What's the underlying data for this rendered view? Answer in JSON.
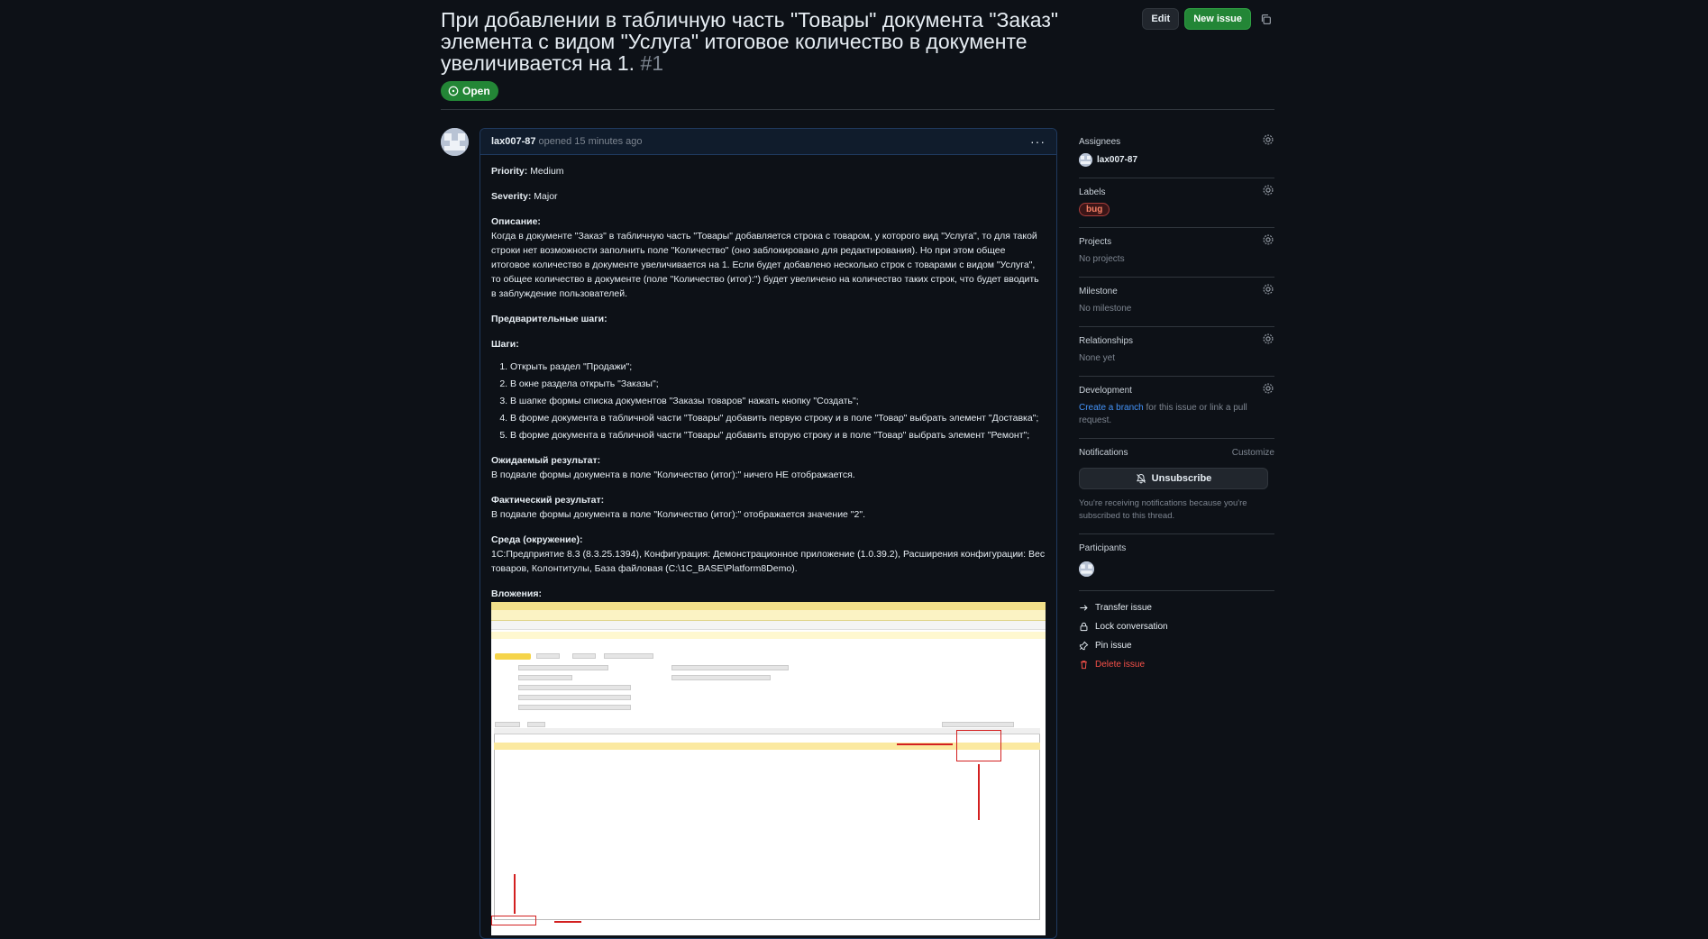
{
  "issue": {
    "title": "При добавлении в табличную часть \"Товары\" документа \"Заказ\" элемента с видом \"Услуга\" итоговое количество в документе увеличивается на 1.",
    "number": "#1",
    "state": "Open",
    "edit_label": "Edit",
    "new_issue_label": "New issue"
  },
  "comment": {
    "author": "lax007-87",
    "meta": "opened 15 minutes ago",
    "priority_label": "Priority:",
    "priority_value": "Medium",
    "severity_label": "Severity:",
    "severity_value": "Major",
    "description_title": "Описание:",
    "description_text": "Когда в документе \"Заказ\" в табличную часть \"Товары\" добавляется строка с товаром, у которого вид \"Услуга\", то для такой строки нет возможности заполнить поле \"Количество\" (оно заблокировано для редактирования). Но при этом общее итоговое количество в документе увеличивается на 1. Если будет добавлено несколько строк с товарами с видом \"Услуга\", то общее количество в документе (поле \"Количество (итог):\") будет увеличено на количество таких строк, что будет вводить в заблуждение пользователей.",
    "prereq_title": "Предварительные шаги:",
    "steps_title": "Шаги:",
    "steps": [
      "Открыть раздел \"Продажи\";",
      "В окне раздела открыть \"Заказы\";",
      "В шапке формы списка документов \"Заказы товаров\" нажать кнопку \"Создать\";",
      "В форме документа в табличной части \"Товары\" добавить первую строку и в поле \"Товар\" выбрать элемент \"Доставка\";",
      "В форме документа в табличной части \"Товары\" добавить вторую строку и в поле \"Товар\" выбрать элемент \"Ремонт\";"
    ],
    "expected_title": "Ожидаемый результат:",
    "expected_text": "В подвале формы документа в поле \"Количество (итог):\" ничего НЕ отображается.",
    "actual_title": "Фактический результат:",
    "actual_text": "В подвале формы документа в поле \"Количество (итог):\" отображается значение \"2\".",
    "env_title": "Среда (окружение):",
    "env_text": "1С:Предприятие 8.3 (8.3.25.1394), Конфигурация: Демонстрационное приложение (1.0.39.2), Расширения конфигурации: Вес товаров, Колонтитулы, База файловая (C:\\1C_BASE\\Platform8Demo).",
    "attachments_title": "Вложения:"
  },
  "sidebar": {
    "assignees_title": "Assignees",
    "assignee_name": "lax007-87",
    "labels_title": "Labels",
    "label_bug": "bug",
    "projects_title": "Projects",
    "projects_value": "No projects",
    "milestone_title": "Milestone",
    "milestone_value": "No milestone",
    "relationships_title": "Relationships",
    "relationships_value": "None yet",
    "development_title": "Development",
    "development_link": "Create a branch",
    "development_rest": " for this issue or link a pull request.",
    "notifications_title": "Notifications",
    "customize_label": "Customize",
    "unsubscribe_label": "Unsubscribe",
    "notif_text": "You're receiving notifications because you're subscribed to this thread.",
    "participants_title": "Participants",
    "actions": {
      "transfer": "Transfer issue",
      "lock": "Lock conversation",
      "pin": "Pin issue",
      "delete": "Delete issue"
    }
  },
  "colors": {
    "background": "#0d1117",
    "open_green": "#238636",
    "link_blue": "#4493f8",
    "danger_red": "#f85149"
  }
}
